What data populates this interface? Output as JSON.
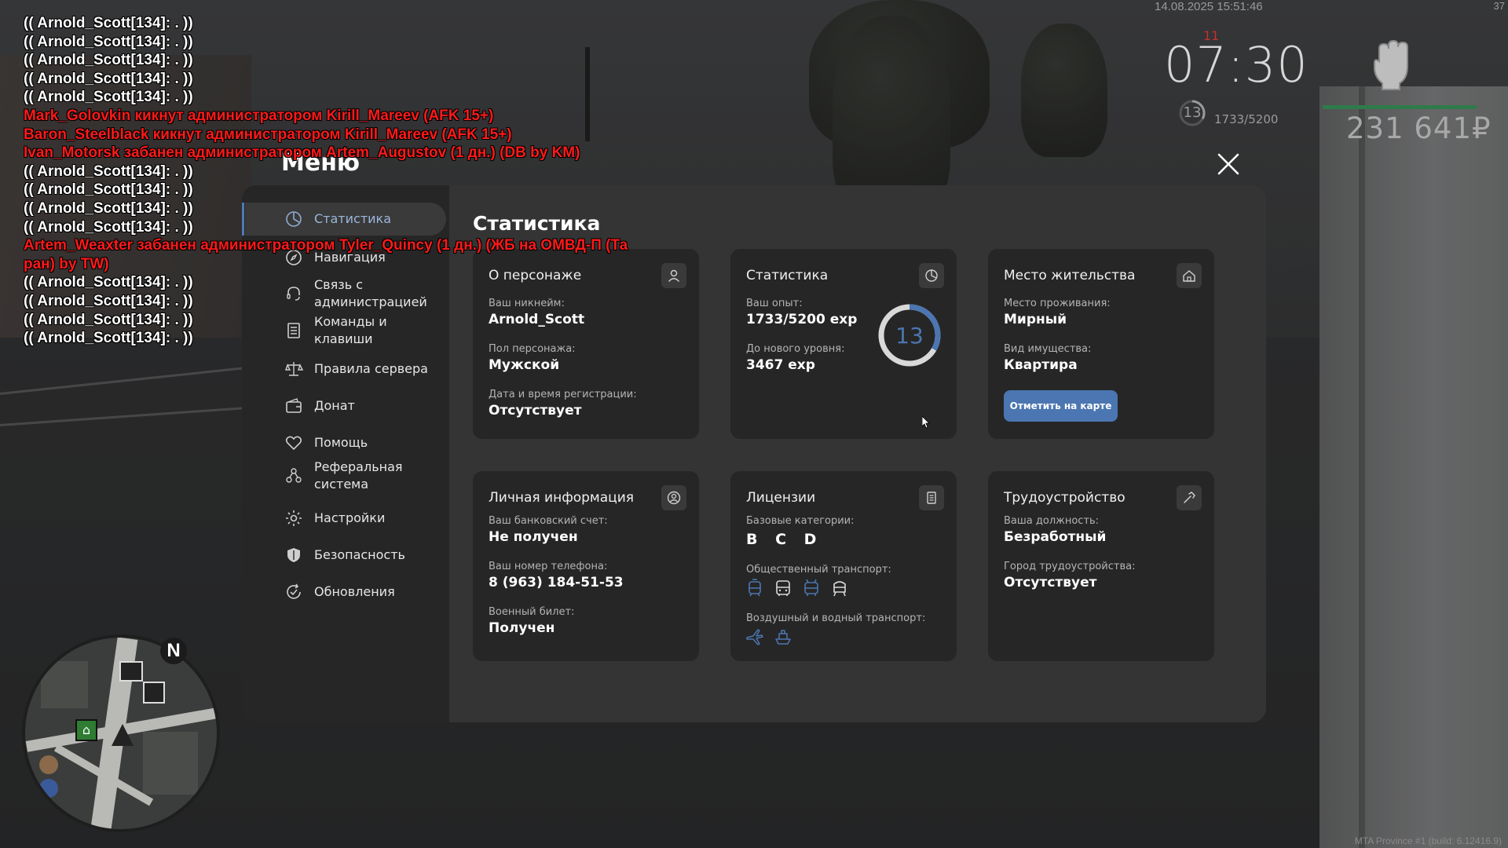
{
  "chat": [
    {
      "text": "(( Arnold_Scott[134]: . ))",
      "kind": "info"
    },
    {
      "text": "(( Arnold_Scott[134]: . ))",
      "kind": "info"
    },
    {
      "text": "(( Arnold_Scott[134]: . ))",
      "kind": "info"
    },
    {
      "text": "(( Arnold_Scott[134]: . ))",
      "kind": "info"
    },
    {
      "text": "(( Arnold_Scott[134]: . ))",
      "kind": "info"
    },
    {
      "text": "Mark_Golovkin кикнут администратором Kirill_Mareev (AFK 15+)",
      "kind": "admin"
    },
    {
      "text": "Baron_Steelblack кикнут администратором Kirill_Mareev (AFK 15+)",
      "kind": "admin"
    },
    {
      "text": "Ivan_Motorsk забанен администратором Artem_Augustov (1 дн.) (DB by KM)",
      "kind": "admin"
    },
    {
      "text": "(( Arnold_Scott[134]: . ))",
      "kind": "info"
    },
    {
      "text": "(( Arnold_Scott[134]: . ))",
      "kind": "info"
    },
    {
      "text": "(( Arnold_Scott[134]: . ))",
      "kind": "info"
    },
    {
      "text": "(( Arnold_Scott[134]: . ))",
      "kind": "info"
    },
    {
      "text": "Artem_Weaxter забанен администратором Tyler_Quincy (1 дн.) (ЖБ на ОМВД-П (Та\nран) by TW)",
      "kind": "admin"
    },
    {
      "text": "(( Arnold_Scott[134]: . ))",
      "kind": "info"
    },
    {
      "text": "(( Arnold_Scott[134]: . ))",
      "kind": "info"
    },
    {
      "text": "(( Arnold_Scott[134]: . ))",
      "kind": "info"
    },
    {
      "text": "(( Arnold_Scott[134]: . ))",
      "kind": "info"
    }
  ],
  "hud": {
    "datetime": "14.08.2025 15:51:46",
    "corner": "37",
    "clock": "07:30",
    "tick": "11",
    "level": "13",
    "exp": "1733/5200",
    "money": "231 641₽",
    "build": "MTA Province #1 (build: 6.12416.9)"
  },
  "menu": {
    "title": "Меню",
    "nav": [
      {
        "label": "Статистика",
        "icon": "pie-chart-icon",
        "active": true
      },
      {
        "label": "Навигация",
        "icon": "compass-icon"
      },
      {
        "label": "Связь с администрацией",
        "icon": "headset-icon"
      },
      {
        "label": "Команды и клавиши",
        "icon": "document-list-icon"
      },
      {
        "label": "Правила сервера",
        "icon": "scales-icon"
      },
      {
        "label": "Донат",
        "icon": "wallet-icon"
      },
      {
        "label": "Помощь",
        "icon": "handshake-heart-icon"
      },
      {
        "label": "Реферальная система",
        "icon": "referral-network-icon"
      },
      {
        "label": "Настройки",
        "icon": "gear-icon"
      },
      {
        "label": "Безопасность",
        "icon": "shield-icon"
      },
      {
        "label": "Обновления",
        "icon": "refresh-check-icon"
      }
    ],
    "content_title": "Статистика",
    "character": {
      "title": "О персонаже",
      "nickname_label": "Ваш никнейм:",
      "nickname": "Arnold_Scott",
      "gender_label": "Пол персонажа:",
      "gender": "Мужской",
      "reg_label": "Дата и время регистрации:",
      "reg": "Отсутствует"
    },
    "stats": {
      "title": "Статистика",
      "exp_label": "Ваш опыт:",
      "exp": "1733/5200 exp",
      "next_label": "До нового уровня:",
      "next": "3467 exp",
      "level": "13",
      "progress": 0.333
    },
    "residence": {
      "title": "Место жительства",
      "place_label": "Место проживания:",
      "place": "Мирный",
      "property_label": "Вид имущества:",
      "property": "Квартира",
      "button": "Отметить на карте"
    },
    "personal": {
      "title": "Личная информация",
      "bank_label": "Ваш банковский счет:",
      "bank": "Не получен",
      "phone_label": "Ваш номер телефона:",
      "phone": "8 (963) 184-51-53",
      "military_label": "Военный билет:",
      "military": "Получен"
    },
    "licenses": {
      "title": "Лицензии",
      "base_label": "Базовые категории:",
      "base": "B C D",
      "public_label": "Общественный транспорт:",
      "air_label": "Воздушный и водный транспорт:"
    },
    "job": {
      "title": "Трудоустройство",
      "position_label": "Ваша должность:",
      "position": "Безработный",
      "city_label": "Город трудоустройства:",
      "city": "Отсутствует"
    }
  },
  "colors": {
    "accent": "#4b76b1",
    "admin_chat": "#ff1a1a",
    "money_bar": "#2f7a4b"
  }
}
